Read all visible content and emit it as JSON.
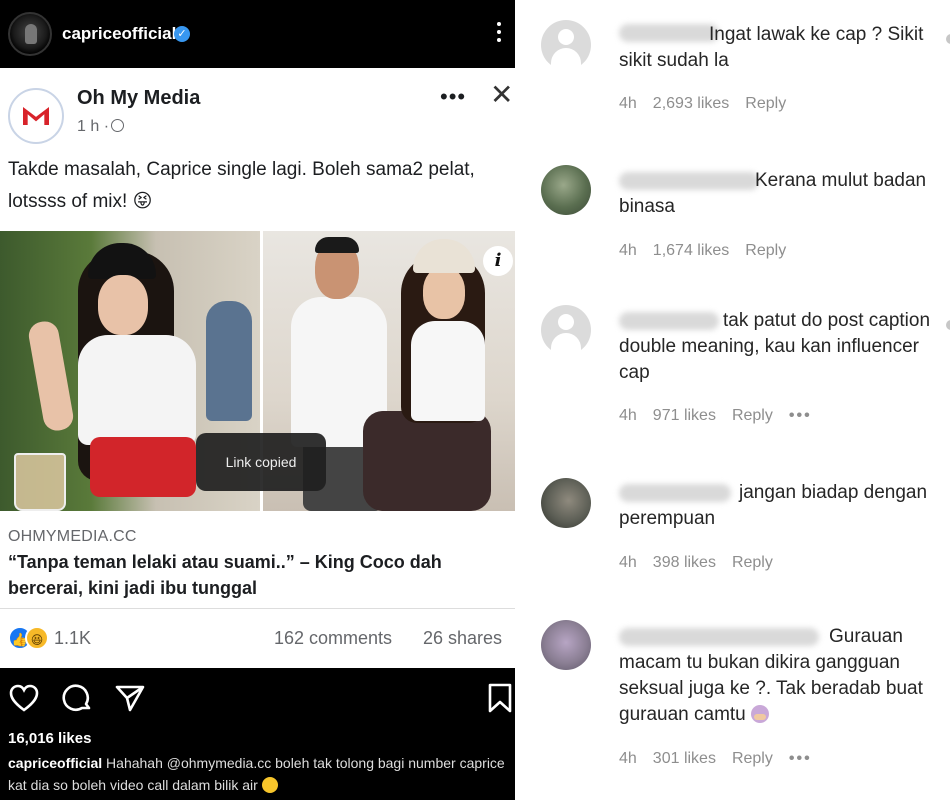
{
  "instagram": {
    "username": "capriceofficial",
    "likes": "16,016 likes",
    "caption_user": "capriceofficial",
    "caption_text": "Hahahah @ohmymedia.cc boleh tak tolong bagi number caprice kat dia so boleh video call dalam bilik air"
  },
  "facebook_post": {
    "page_name": "Oh My Media",
    "time": "1 h ·",
    "text": "Takde masalah, Caprice single lagi. Boleh sama2 pelat, lotssss of mix! 😝",
    "info_icon": "i",
    "toast": "Link copied",
    "link_domain": "OHMYMEDIA.CC",
    "link_title": "“Tanpa teman lelaki atau suami..” – King Coco dah bercerai, kini jadi ibu tunggal",
    "reaction_count": "1.1K",
    "comments_count": "162 comments",
    "shares_count": "26 shares"
  },
  "comments": [
    {
      "text": "Ingat lawak ke cap ? Sikit sikit sudah la",
      "time": "4h",
      "likes": "2,693 likes",
      "reply": "Reply"
    },
    {
      "text": "Kerana mulut badan binasa",
      "time": "4h",
      "likes": "1,674 likes",
      "reply": "Reply"
    },
    {
      "text": "tak patut do post caption double meaning, kau kan influencer cap",
      "time": "4h",
      "likes": "971 likes",
      "reply": "Reply"
    },
    {
      "text": "jangan biadap dengan perempuan",
      "time": "4h",
      "likes": "398 likes",
      "reply": "Reply"
    },
    {
      "text": "Gurauan macam tu bukan dikira gangguan seksual juga ke ?. Tak beradab buat gurauan camtu",
      "time": "4h",
      "likes": "301 likes",
      "reply": "Reply"
    }
  ],
  "colors": {
    "ig_bg": "#000000",
    "fb_blue": "#1877f2",
    "meta_gray": "#8e8e8e",
    "verified_blue": "#3897f0"
  },
  "icons": [
    "verified-icon",
    "more-icon",
    "globe-icon",
    "close-icon",
    "heart-icon",
    "comment-icon",
    "share-icon",
    "save-icon",
    "info-icon",
    "like-reaction-icon",
    "haha-reaction-icon"
  ]
}
